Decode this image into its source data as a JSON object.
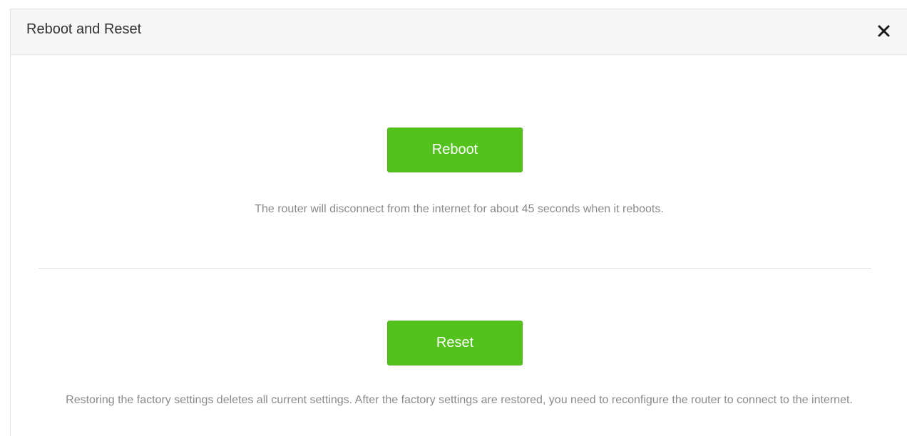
{
  "dialog": {
    "title": "Reboot and Reset",
    "close_icon": "close-icon"
  },
  "reboot": {
    "button_label": "Reboot",
    "description": "The router will disconnect from the internet for about 45 seconds when it reboots."
  },
  "reset": {
    "button_label": "Reset",
    "description": "Restoring the factory settings deletes all current settings. After the factory settings are restored, you need to reconfigure the router to connect to the internet."
  },
  "colors": {
    "button_green": "#53c21c",
    "header_bg": "#f7f7f7",
    "description_text": "#8a8a8a"
  }
}
